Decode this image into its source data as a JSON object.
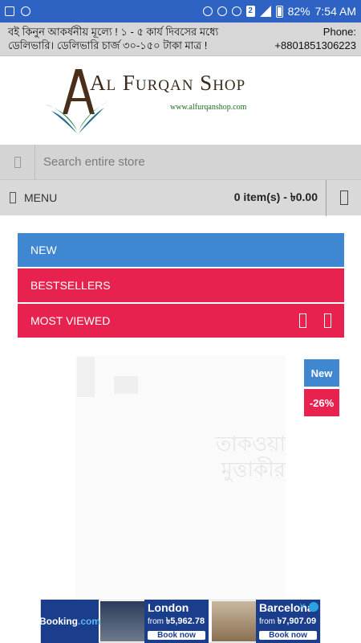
{
  "status_bar": {
    "battery": "82%",
    "time": "7:54 AM",
    "sim": "2"
  },
  "notice": {
    "message": "বই কিনুন আকর্ষনীয় মূল্যে ! ১ - ৫ কার্য দিবসের মধ্যে ডেলিভারি। ডেলিভারি চার্জ ৩০-১৫০ টাকা মাত্র !",
    "phone_label": "Phone:",
    "phone_number": "+8801851306223"
  },
  "brand": {
    "name": "Al Furqan Shop",
    "url": "www.alfurqanshop.com",
    "colors": {
      "letter": "#4a2e1a",
      "leaf": "#2e8b57"
    }
  },
  "search": {
    "placeholder": "Search entire store",
    "icon": "search-icon"
  },
  "menu": {
    "label": "MENU",
    "cart_summary": "0 item(s) - ৳0.00",
    "icon": "hamburger-icon",
    "cart_icon": "cart-icon"
  },
  "tabs": [
    {
      "label": "NEW",
      "color": "#3f87d0"
    },
    {
      "label": "BESTSELLERS",
      "color": "#e8224e"
    },
    {
      "label": "MOST VIEWED",
      "color": "#e8224e"
    }
  ],
  "product": {
    "badge_new": "New",
    "badge_discount": "-26%",
    "cover_text": "তাকওয়া মুত্তাকীর"
  },
  "ad": {
    "brand_a": "Booking",
    "brand_b": ".com",
    "city1": "London",
    "price1_prefix": "from",
    "price1": "৳5,962.78",
    "city2": "Barcelona",
    "price2_prefix": "from",
    "price2": "৳7,907.09",
    "cta": "Book now"
  }
}
